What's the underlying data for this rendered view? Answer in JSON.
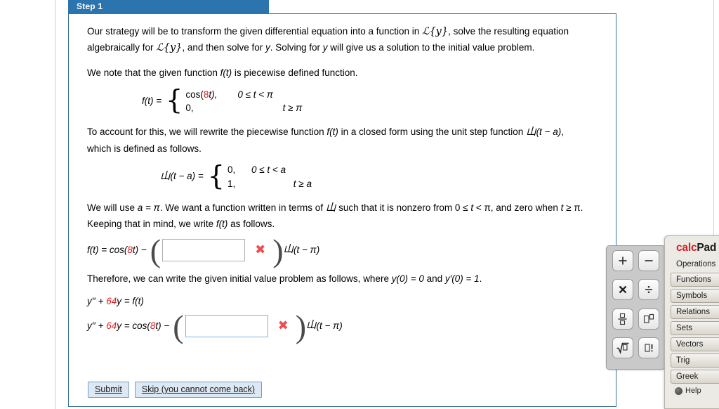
{
  "step": {
    "label": "Step 1"
  },
  "content": {
    "p1_a": "Our strategy will be to transform the given differential equation into a function in ",
    "p1_L1": "ℒ{y}",
    "p1_b": ", solve the resulting equation algebraically for ",
    "p1_L2": "ℒ{y}",
    "p1_c": ", and then solve for ",
    "p1_y": "y",
    "p1_d": ". Solving for ",
    "p1_y2": "y",
    "p1_e": " will give us a solution to the initial value problem.",
    "p2_a": "We note that the given function ",
    "p2_f": "f(t)",
    "p2_b": " is piecewise defined function.",
    "fdef": {
      "lhs": "f(t)  =",
      "row1_a_pre": "cos(",
      "row1_a_num": "8",
      "row1_a_post": "t),",
      "row1_b": "0 ≤ t < π",
      "row2_a": "0,",
      "row2_b": "t ≥ π"
    },
    "p3_a": "To account for this, we will rewrite the piecewise function ",
    "p3_f": "f(t)",
    "p3_b": " in a closed form using the unit step function ",
    "p3_U": "山",
    "p3_Uarg": "(t − a)",
    "p3_c": ", which is defined as follows.",
    "udef": {
      "lhs_U": "山",
      "lhs_rest": "(t − a)  =",
      "row1_a": "0,",
      "row1_b": "0 ≤ t < a",
      "row2_a": "1,",
      "row2_b": "t ≥ a"
    },
    "p4_a": "We will use ",
    "p4_a_eq": "a = π",
    "p4_b": ". We want a function written in terms of ",
    "p4_U": "山",
    "p4_c": " such that it is nonzero from 0 ≤ ",
    "p4_t": "t",
    "p4_d": " < π, and zero when ",
    "p4_t2": "t",
    "p4_e": " ≥ π. Keeping that in mind, we write ",
    "p4_f": "f(t)",
    "p4_g": " as follows.",
    "eq1": {
      "lead_a": "f(t)  =  cos(",
      "lead_num": "8",
      "lead_b": "t)  −",
      "paren_open": "(",
      "input_value": "",
      "input_placeholder": "",
      "mark": "✖",
      "paren_close": ")",
      "tail_U": "山",
      "tail_rest": "(t − π)"
    },
    "p5_a": "Therefore, we can write the given initial value problem as follows, where ",
    "p5_y0": "y(0) = 0",
    "p5_b": " and ",
    "p5_yp0": "y′(0) = 1",
    "p5_c": ".",
    "eq2": {
      "lead_a": "y′′  +  ",
      "lead_num": "64",
      "lead_b": "y   =   f(t)"
    },
    "eq3": {
      "lead_a": "y′′  +  ",
      "lead_num": "64",
      "lead_b": "y   =   cos(",
      "lead_num2": "8",
      "lead_c": "t)  −",
      "paren_open": "(",
      "input_value": "",
      "input_placeholder": "",
      "mark": "✖",
      "paren_close": ")",
      "tail_U": "山",
      "tail_rest": "(t − π)"
    }
  },
  "buttons": {
    "submit": "Submit",
    "skip": "Skip (you cannot come back)"
  },
  "keypad": {
    "keys": [
      {
        "name": "plus",
        "glyph": "+"
      },
      {
        "name": "minus",
        "glyph": "−"
      },
      {
        "name": "multiply",
        "glyph": "✖"
      },
      {
        "name": "divide",
        "glyph": "÷"
      },
      {
        "name": "fraction",
        "glyph": "▫̲▫"
      },
      {
        "name": "power",
        "glyph": "▭▫"
      },
      {
        "name": "square-root",
        "glyph": "√▫"
      },
      {
        "name": "factorial",
        "glyph": "▫!"
      }
    ]
  },
  "calcpad": {
    "title_red": "calc",
    "title_black": "Pad",
    "tabs": [
      {
        "label": "Operations",
        "active": true
      },
      {
        "label": "Functions",
        "active": false
      },
      {
        "label": "Symbols",
        "active": false
      },
      {
        "label": "Relations",
        "active": false
      },
      {
        "label": "Sets",
        "active": false
      },
      {
        "label": "Vectors",
        "active": false
      },
      {
        "label": "Trig",
        "active": false
      },
      {
        "label": "Greek",
        "active": false
      }
    ],
    "help": "Help"
  },
  "colors": {
    "tab_blue": "#2b74ad",
    "border_blue": "#3a6f9a",
    "accent_red": "#e01b1b",
    "x_red": "#ef4b52",
    "focus_border": "#7fb2da",
    "calcpad_red": "#d81f26"
  }
}
